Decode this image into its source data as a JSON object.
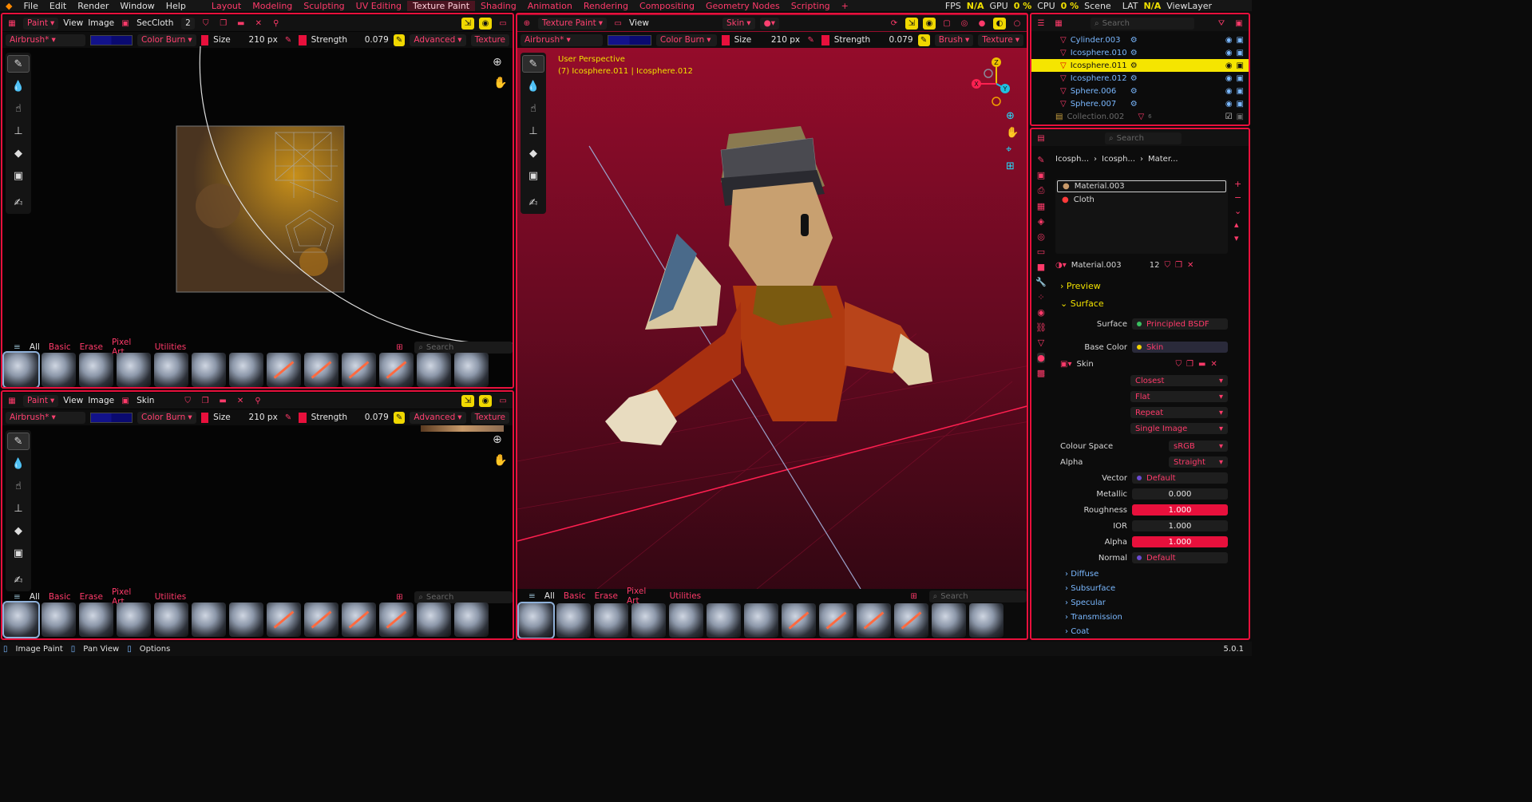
{
  "topbar": {
    "menus": [
      "File",
      "Edit",
      "Render",
      "Window",
      "Help"
    ],
    "workspaces": [
      "Layout",
      "Modeling",
      "Sculpting",
      "UV Editing",
      "Texture Paint",
      "Shading",
      "Animation",
      "Rendering",
      "Compositing",
      "Geometry Nodes",
      "Scripting"
    ],
    "active_workspace": "Texture Paint",
    "add": "+",
    "fps_label": "FPS",
    "fps_value": "N/A",
    "gpu_label": "GPU",
    "gpu_value": "0 %",
    "cpu_label": "CPU",
    "cpu_value": "0 %",
    "scene": "Scene",
    "lat_label": "LAT",
    "lat_value": "N/A",
    "viewlayer": "ViewLayer"
  },
  "brush_settings": {
    "brush": "Airbrush*",
    "blend": "Color Burn",
    "size_label": "Size",
    "size_value": "210 px",
    "strength_label": "Strength",
    "strength_value": "0.079",
    "advanced": "Advanced",
    "texture": "Texture",
    "brush_menu": "Brush"
  },
  "img1": {
    "mode": "Paint",
    "view": "View",
    "image": "Image",
    "name": "SecCloth",
    "users": "2"
  },
  "img2": {
    "mode": "Paint",
    "view": "View",
    "image": "Image",
    "name": "Skin"
  },
  "viewport": {
    "mode": "Texture Paint",
    "view": "View",
    "material": "Skin",
    "title": "User Perspective",
    "subtitle": "(7) Icosphere.011 | Icosphere.012",
    "axes": {
      "z": "Z",
      "y": "Y",
      "x": "X"
    }
  },
  "assets": {
    "categories": [
      "All",
      "Basic",
      "Erase",
      "Pixel Art",
      "Utilities"
    ],
    "search_placeholder": "Search"
  },
  "outliner": {
    "search_placeholder": "Search",
    "items": [
      {
        "name": "Cylinder.003",
        "sel": false
      },
      {
        "name": "Icosphere.010",
        "sel": false
      },
      {
        "name": "Icosphere.011",
        "sel": true
      },
      {
        "name": "Icosphere.012",
        "sel": false
      },
      {
        "name": "Sphere.006",
        "sel": false
      },
      {
        "name": "Sphere.007",
        "sel": false
      }
    ],
    "collection": "Collection.002",
    "collection_count": "6"
  },
  "properties": {
    "search_placeholder": "Search",
    "breadcrumb": [
      "Icosph...",
      "Icosph...",
      "Mater..."
    ],
    "slots": [
      "Material.003",
      "Cloth"
    ],
    "material_name": "Material.003",
    "material_users": "12",
    "preview": "Preview",
    "surface_header": "Surface",
    "surface_label": "Surface",
    "surface_value": "Principled BSDF",
    "basecolor_label": "Base Color",
    "basecolor_value": "Skin",
    "image_name": "Skin",
    "interp": "Closest",
    "projection": "Flat",
    "extension": "Repeat",
    "source": "Single Image",
    "colorspace_label": "Colour Space",
    "colorspace_value": "sRGB",
    "alpha_mode_label": "Alpha",
    "alpha_mode_value": "Straight",
    "vector_label": "Vector",
    "vector_value": "Default",
    "metallic_label": "Metallic",
    "metallic_value": "0.000",
    "roughness_label": "Roughness",
    "roughness_value": "1.000",
    "ior_label": "IOR",
    "ior_value": "1.000",
    "alpha_label": "Alpha",
    "alpha_value": "1.000",
    "normal_label": "Normal",
    "normal_value": "Default",
    "subpanels": [
      "Diffuse",
      "Subsurface",
      "Specular",
      "Transmission",
      "Coat"
    ]
  },
  "statusbar": {
    "image_paint": "Image Paint",
    "pan_view": "Pan View",
    "options": "Options",
    "version": "5.0.1"
  }
}
